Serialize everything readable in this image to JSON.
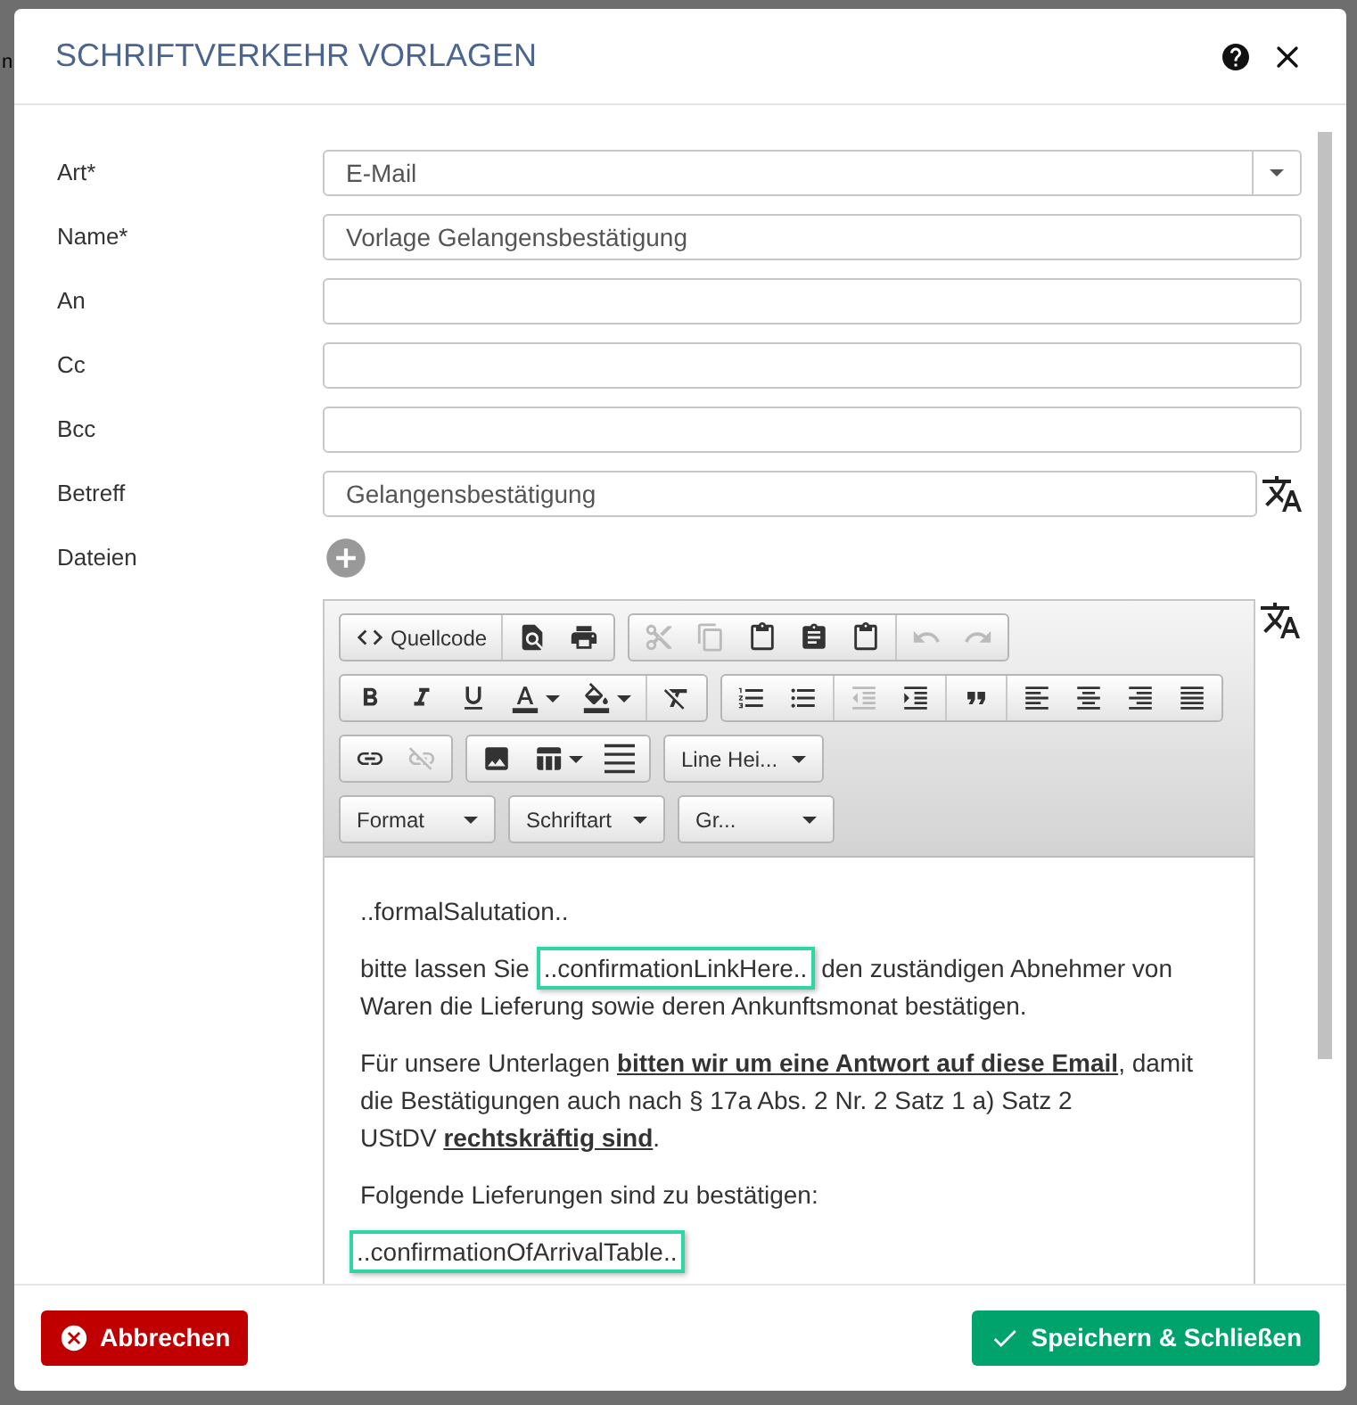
{
  "background": {
    "text": "n"
  },
  "dialog": {
    "title": "SCHRIFTVERKEHR VORLAGEN"
  },
  "form": {
    "fields": [
      {
        "label": "Art*",
        "kind": "select",
        "value": "E-Mail"
      },
      {
        "label": "Name*",
        "kind": "text",
        "value": "Vorlage Gelangensbestätigung"
      },
      {
        "label": "An",
        "kind": "text"
      },
      {
        "label": "Cc",
        "kind": "text"
      },
      {
        "label": "Bcc",
        "kind": "text"
      },
      {
        "label": "Betreff",
        "kind": "translatable",
        "value": "Gelangensbestätigung"
      },
      {
        "label": "Dateien",
        "kind": "files"
      }
    ]
  },
  "editor": {
    "toolbar": [
      [
        [
          [
            {
              "kind": "labeled",
              "label": "Quellcode",
              "disabled": false
            }
          ],
          [
            {
              "kind": "icon",
              "disabled": false
            },
            {
              "kind": "icon",
              "disabled": false
            }
          ]
        ],
        [
          [
            {
              "kind": "icon",
              "disabled": true
            },
            {
              "kind": "icon",
              "disabled": true
            },
            {
              "kind": "icon",
              "disabled": false
            },
            {
              "kind": "icon",
              "disabled": false
            },
            {
              "kind": "icon",
              "disabled": false
            }
          ],
          [
            {
              "kind": "icon",
              "disabled": true
            },
            {
              "kind": "icon",
              "disabled": true
            }
          ]
        ]
      ],
      [
        [
          [
            {
              "kind": "icon",
              "disabled": false
            },
            {
              "kind": "icon",
              "disabled": false
            },
            {
              "kind": "icon",
              "disabled": false
            },
            {
              "kind": "split",
              "disabled": false
            },
            {
              "kind": "split",
              "disabled": false
            }
          ],
          [
            {
              "kind": "icon",
              "disabled": false
            }
          ]
        ],
        [
          [
            {
              "kind": "icon",
              "disabled": false
            },
            {
              "kind": "icon",
              "disabled": false
            }
          ],
          [
            {
              "kind": "icon",
              "disabled": true
            },
            {
              "kind": "icon",
              "disabled": false
            }
          ],
          [
            {
              "kind": "icon",
              "disabled": false
            }
          ],
          [
            {
              "kind": "icon",
              "disabled": false
            },
            {
              "kind": "icon",
              "disabled": false
            },
            {
              "kind": "icon",
              "disabled": false
            },
            {
              "kind": "icon",
              "disabled": false
            }
          ]
        ]
      ],
      [
        [
          [
            {
              "kind": "icon",
              "disabled": false
            },
            {
              "kind": "icon",
              "disabled": true
            }
          ]
        ],
        [
          [
            {
              "kind": "icon",
              "disabled": false
            },
            {
              "kind": "split",
              "disabled": false
            },
            {
              "kind": "icon",
              "disabled": false
            }
          ]
        ],
        [
          [
            {
              "kind": "dropdown",
              "label": "Line Hei...",
              "disabled": false
            }
          ]
        ]
      ],
      [
        [
          [
            {
              "kind": "dropdown",
              "label": "Format",
              "disabled": false
            }
          ]
        ],
        [
          [
            {
              "kind": "dropdown",
              "label": "Schriftart",
              "disabled": false
            }
          ]
        ],
        [
          [
            {
              "kind": "dropdown",
              "label": "Gr...",
              "disabled": false
            }
          ]
        ]
      ]
    ],
    "paragraphs": [
      {
        "segments": [
          {
            "kind": "text",
            "text": "..formalSalutation.."
          }
        ]
      },
      {
        "segments": [
          {
            "kind": "text",
            "text": "bitte lassen Sie "
          },
          {
            "kind": "placeholder",
            "text": "..confirmationLinkHere.."
          },
          {
            "kind": "text",
            "text": " den zuständigen Abnehmer von Waren die Lieferung sowie deren Ankunftsmonat bestätigen."
          }
        ]
      },
      {
        "segments": [
          {
            "kind": "line",
            "text": "Für unsere Unterlagen **bitten wir um eine Antwort auf diese Email**, damit die Bestätigungen auch nach § 17a Abs. 2 Nr. 2 Satz 1 a) Satz 2"
          },
          {
            "kind": "line",
            "text": "UStDV **rechtskräftig sind**."
          }
        ]
      },
      {
        "segments": [
          {
            "kind": "text",
            "text": "Folgende Lieferungen sind zu bestätigen:"
          }
        ]
      },
      {
        "segments": [
          {
            "kind": "placeholder",
            "text": "..confirmationOfArrivalTable.."
          }
        ]
      }
    ]
  },
  "footer": {
    "cancel": "Abbrechen",
    "save": "Speichern & Schließen"
  }
}
